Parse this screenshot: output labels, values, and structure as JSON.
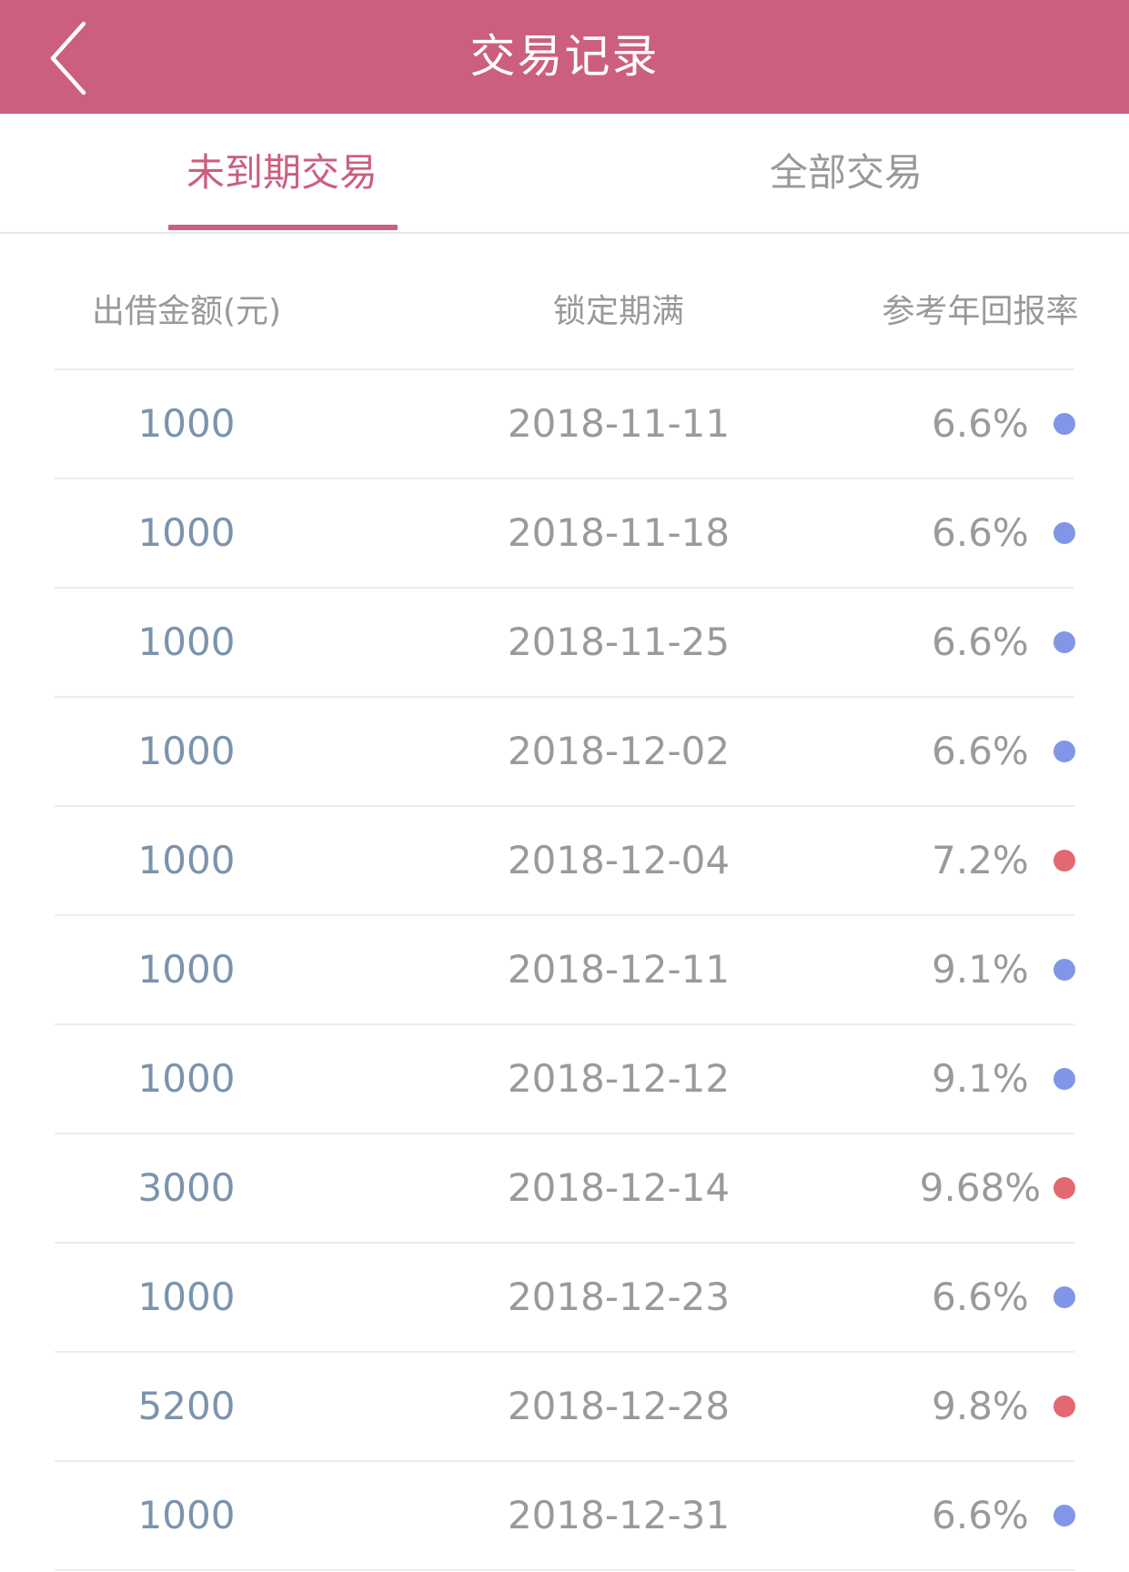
{
  "header": {
    "title": "交易记录",
    "back_icon": "chevron-left-icon",
    "background_color": "#cc5f7e"
  },
  "tabs": [
    {
      "label": "未到期交易",
      "active": true
    },
    {
      "label": "全部交易",
      "active": false
    }
  ],
  "table": {
    "columns": [
      "出借金额(元)",
      "锁定期满",
      "参考年回报率"
    ],
    "rows": [
      {
        "amount": "1000",
        "date": "2018-11-11",
        "rate": "6.6%",
        "status": "blue"
      },
      {
        "amount": "1000",
        "date": "2018-11-18",
        "rate": "6.6%",
        "status": "blue"
      },
      {
        "amount": "1000",
        "date": "2018-11-25",
        "rate": "6.6%",
        "status": "blue"
      },
      {
        "amount": "1000",
        "date": "2018-12-02",
        "rate": "6.6%",
        "status": "blue"
      },
      {
        "amount": "1000",
        "date": "2018-12-04",
        "rate": "7.2%",
        "status": "red"
      },
      {
        "amount": "1000",
        "date": "2018-12-11",
        "rate": "9.1%",
        "status": "blue"
      },
      {
        "amount": "1000",
        "date": "2018-12-12",
        "rate": "9.1%",
        "status": "blue"
      },
      {
        "amount": "3000",
        "date": "2018-12-14",
        "rate": "9.68%",
        "status": "red"
      },
      {
        "amount": "1000",
        "date": "2018-12-23",
        "rate": "6.6%",
        "status": "blue"
      },
      {
        "amount": "5200",
        "date": "2018-12-28",
        "rate": "9.8%",
        "status": "red"
      },
      {
        "amount": "1000",
        "date": "2018-12-31",
        "rate": "6.6%",
        "status": "blue"
      }
    ]
  },
  "colors": {
    "accent": "#cc5f7e",
    "dot_blue": "#8196e6",
    "dot_red": "#e2696f",
    "amount_text": "#7b93ad"
  }
}
